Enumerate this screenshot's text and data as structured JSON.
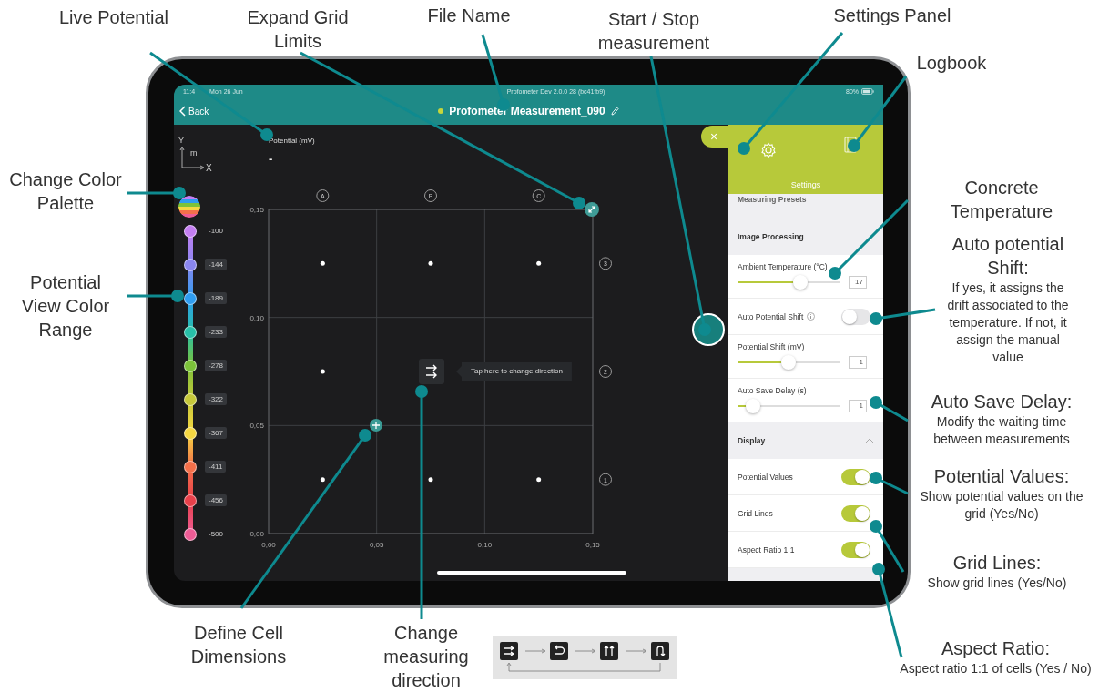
{
  "annotations": [
    {
      "title": "Live Potential"
    },
    {
      "title": "Expand Grid Limits"
    },
    {
      "title": "File Name"
    },
    {
      "title": "Start / Stop measurement"
    },
    {
      "title": "Settings Panel"
    },
    {
      "title": "Logbook"
    },
    {
      "title": "Change Color Palette"
    },
    {
      "title": "Potential View Color Range"
    },
    {
      "title": "Concrete Temperature"
    },
    {
      "title": "Auto potential Shift:",
      "note": "If yes, it assigns the drift associated to the temperature. If not, it assign the manual value"
    },
    {
      "title": "Auto Save Delay:",
      "note": "Modify the waiting time between measurements"
    },
    {
      "title": "Potential Values:",
      "note": "Show potential values on the grid (Yes/No)"
    },
    {
      "title": "Grid Lines:",
      "note": "Show grid lines (Yes/No)"
    },
    {
      "title": "Define Cell Dimensions"
    },
    {
      "title": "Change measuring direction"
    },
    {
      "title": "Aspect Ratio:",
      "note": "Aspect ratio 1:1 of cells (Yes / No)"
    }
  ],
  "status_bar": {
    "time": "11:4",
    "date": "Mon 26 Jun",
    "app_version": "Profometer Dev 2.0.0 28 (bc41fb9)",
    "battery": "80%"
  },
  "nav_bar": {
    "back": "Back",
    "file_name": "Profometer Measurement_090"
  },
  "axis_legend": {
    "y": "Y",
    "unit": "m",
    "x": "X"
  },
  "live_potential": {
    "label": "Potential (mV)",
    "value": "-"
  },
  "color_range": [
    {
      "label": "-100",
      "color": "#c47ef2",
      "kind": "end"
    },
    {
      "label": "-144",
      "color": "#8a86f0",
      "kind": "mid"
    },
    {
      "label": "-189",
      "color": "#2f9df0",
      "kind": "mid"
    },
    {
      "label": "-233",
      "color": "#27c0a8",
      "kind": "mid"
    },
    {
      "label": "-278",
      "color": "#7cc23a",
      "kind": "mid"
    },
    {
      "label": "-322",
      "color": "#c6c83a",
      "kind": "mid"
    },
    {
      "label": "-367",
      "color": "#f5d742",
      "kind": "mid"
    },
    {
      "label": "-411",
      "color": "#f4704a",
      "kind": "mid"
    },
    {
      "label": "-456",
      "color": "#e8404a",
      "kind": "mid"
    },
    {
      "label": "-500",
      "color": "#ee5c95",
      "kind": "end"
    }
  ],
  "grid": {
    "columns": [
      "A",
      "B",
      "C"
    ],
    "rows": [
      "3",
      "2",
      "1"
    ],
    "yticks": [
      "0,15",
      "0,10",
      "0,05",
      "0,00"
    ],
    "xticks": [
      "0,00",
      "0,05",
      "0,10",
      "0,15"
    ]
  },
  "direction_tooltip": "Tap here to change direction",
  "settings": {
    "close": "×",
    "title": "Settings",
    "sections": [
      {
        "title": "Measuring Presets"
      },
      {
        "title": "Image Processing",
        "items": [
          {
            "kind": "slider",
            "label": "Ambient Temperature (°C)",
            "level": 0.62,
            "value": "17"
          },
          {
            "kind": "toggle",
            "label": "Auto Potential Shift",
            "info": true,
            "on": false
          },
          {
            "kind": "slider",
            "label": "Potential Shift (mV)",
            "level": 0.5,
            "value": "1"
          },
          {
            "kind": "slider",
            "label": "Auto Save Delay (s)",
            "level": 0.15,
            "value": "1"
          }
        ]
      },
      {
        "title": "Display",
        "expanded": true,
        "items": [
          {
            "kind": "toggle",
            "label": "Potential Values",
            "on": true
          },
          {
            "kind": "toggle",
            "label": "Grid Lines",
            "on": true
          },
          {
            "kind": "toggle",
            "label": "Aspect Ratio 1:1",
            "on": true
          }
        ]
      }
    ]
  }
}
